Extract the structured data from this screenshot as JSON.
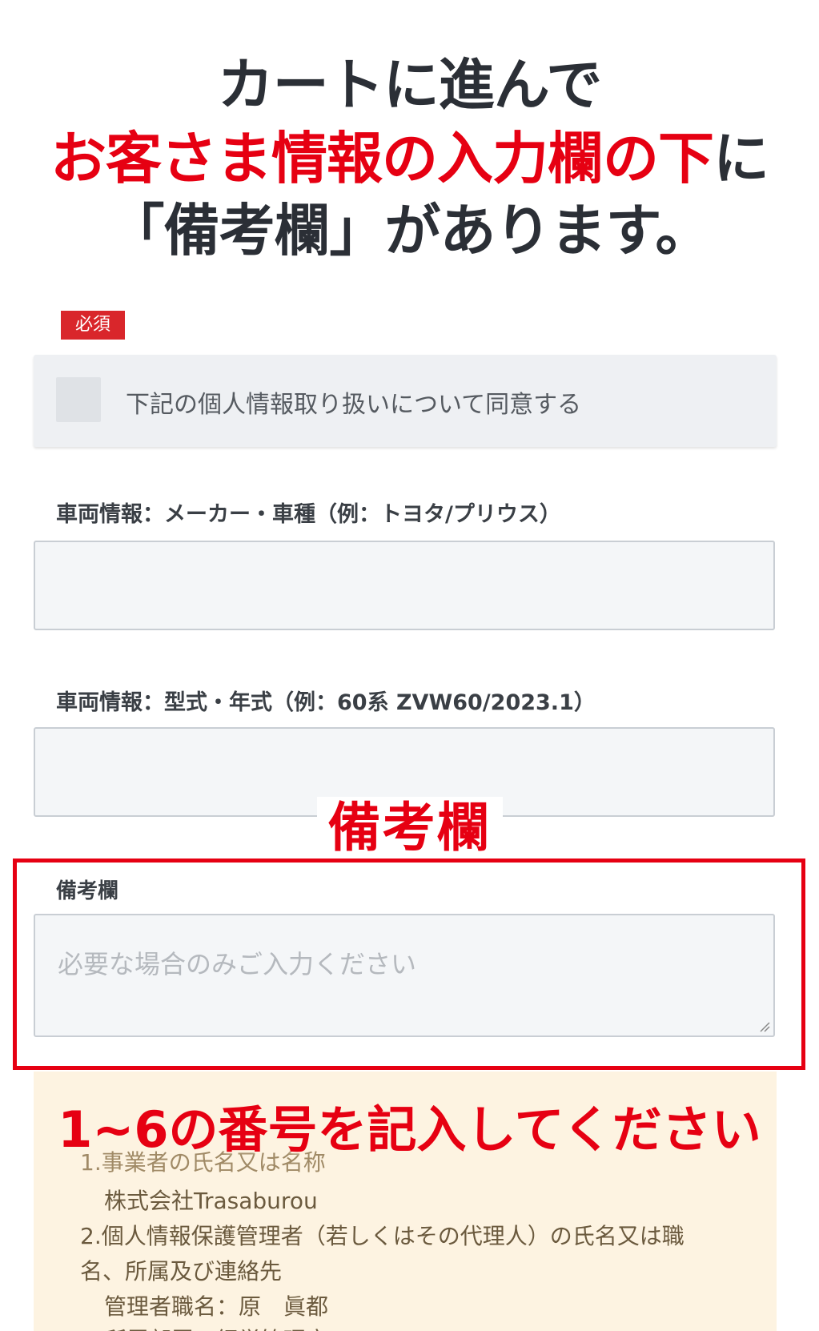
{
  "headline": {
    "line1": "カートに進んで",
    "line2_red": "お客さま情報の入力欄の下",
    "line2_dark": "に",
    "line3": "「備考欄」があります。"
  },
  "form": {
    "required_badge": "必須",
    "consent_text": "下記の個人情報取り扱いについて同意する",
    "vehicle_maker_label": "車両情報：メーカー・車種（例：トヨタ/プリウス）",
    "vehicle_model_label": "車両情報：型式・年式（例：60系 ZVW60/2023.1）",
    "remarks_label": "備考欄",
    "remarks_placeholder": "必要な場合のみご入力ください"
  },
  "annotations": {
    "remarks_callout": "備考欄",
    "number_callout": "1~6の番号を記入してください"
  },
  "privacy": {
    "line1": "1.事業者の氏名又は名称",
    "line2": "株式会社Trasaburou",
    "line3": "2.個人情報保護管理者（若しくはその代理人）の氏名又は職",
    "line4": "名、所属及び連絡先",
    "line5": "管理者職名：原　眞都",
    "line6": "所属部署：経営管理室"
  },
  "colors": {
    "accent_red": "#e60012",
    "badge_red": "#d9262b",
    "privacy_bg": "#fdf3e1"
  }
}
